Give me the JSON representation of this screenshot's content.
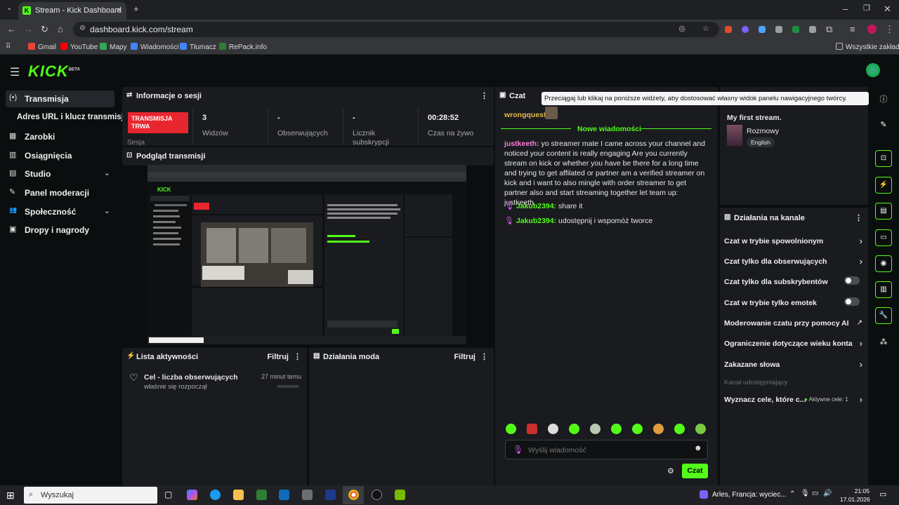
{
  "browser": {
    "tab_title": "Stream - Kick Dashboard",
    "url": "dashboard.kick.com/stream",
    "new_tab": "+",
    "bookmarks": [
      "Gmail",
      "YouTube",
      "Mapy",
      "Wiadomości",
      "Tłumacz",
      "RePack.info"
    ],
    "bookmarks_right": "Wszystkie zakładki"
  },
  "logo": {
    "text": "KICK",
    "sup": "BETA"
  },
  "sidebar": {
    "items": [
      {
        "label": "Transmisja",
        "icon": "(•)"
      },
      {
        "label": "Adres URL i klucz transmisji",
        "icon": ""
      },
      {
        "label": "Zarobki",
        "icon": "▦"
      },
      {
        "label": "Osiągnięcia",
        "icon": "▥"
      },
      {
        "label": "Studio",
        "icon": "▤"
      },
      {
        "label": "Panel moderacji",
        "icon": "✎"
      },
      {
        "label": "Społeczność",
        "icon": "👥"
      },
      {
        "label": "Dropy i nagrody",
        "icon": "▣"
      }
    ]
  },
  "session": {
    "title": "Informacje o sesji",
    "badge": "TRANSMISJA TRWA",
    "sesja": "Sesja",
    "stats": [
      {
        "value": "3",
        "label": "Widzów"
      },
      {
        "value": "-",
        "label": "Obserwujących"
      },
      {
        "value": "-",
        "label": "Licznik subskrypcji"
      },
      {
        "value": "00:28:52",
        "label": "Czas na żywo"
      }
    ]
  },
  "preview": {
    "title": "Podgląd transmisji"
  },
  "activity": {
    "title": "Lista aktywności",
    "filter": "Filtruj",
    "item_title": "Cel - liczba obserwujących",
    "item_sub": "właśnie się rozpoczął",
    "item_time": "27 minut temu"
  },
  "mod_actions": {
    "title": "Działania moda",
    "filter": "Filtruj"
  },
  "chat": {
    "title": "Czat",
    "tooltip": "Przeciągaj lub klikaj na poniższe widżety, aby dostosować własny widok panelu nawigacyjnego twórcy.",
    "first_user": "wrongquest:",
    "new_messages": "Nowe wiadomości",
    "messages": [
      {
        "user": "justkeeth:",
        "text": " yo streamer mate I came across your channel and noticed your content is really engaging Are you currently stream on kick or whether you have be there for a long time and trying to get affilated or partner am a verified streamer on kick and i want to also mingle with order streamer to get partner also and start streaming together let team up: justkeeth"
      },
      {
        "user": "Jakub2394:",
        "text": " share it"
      },
      {
        "user": "Jakub2394:",
        "text": " udostępnij i wspomóż tworce"
      }
    ],
    "placeholder": "Wyślij wiadomość",
    "send": "Czat"
  },
  "stream_info": {
    "title": "My first stream.",
    "category": "Rozmowy",
    "language": "English"
  },
  "channel_actions": {
    "title": "Działania na kanale",
    "items": [
      {
        "label": "Czat w trybie spowolnionym"
      },
      {
        "label": "Czat tylko dla obserwujących"
      },
      {
        "label": "Czat tylko dla subskrybentów"
      },
      {
        "label": "Czat w trybie tylko emotek"
      },
      {
        "label": "Moderowanie czatu przy pomocy AI"
      },
      {
        "label": "Ograniczenie dotyczące wieku konta"
      },
      {
        "label": "Zakazane słowa"
      },
      {
        "label": "Kanał udostępniający"
      },
      {
        "label": "Wyznacz cele, które c..."
      }
    ],
    "goals_badge": "Aktywne cele: 1"
  },
  "taskbar": {
    "search": "Wyszukaj",
    "weather": "Arles, Francja: wyciec...",
    "time": "21:05",
    "date": "17.01.2026"
  },
  "colors": {
    "accent": "#53fc18",
    "live": "#e8262f",
    "bg": "#0b0e0f",
    "panel": "#191b1f"
  }
}
